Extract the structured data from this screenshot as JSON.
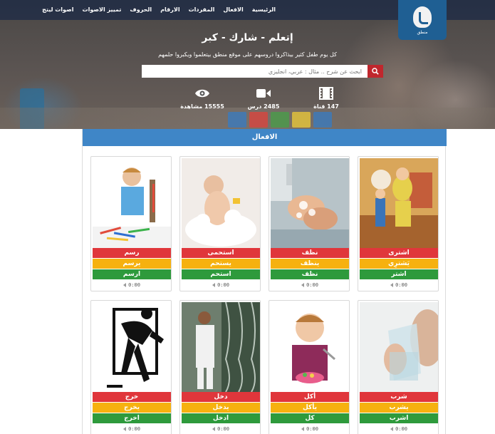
{
  "nav": {
    "items": [
      "الرئيسية",
      "الافعال",
      "المفردات",
      "الارقام",
      "الحروف",
      "تمييز الاصوات",
      "اصوات ليتج"
    ]
  },
  "hero": {
    "title": "إتعلم - شارك - كبر",
    "subtitle": "كل يوم طفل كثير بيذاكروا دروسهم على موقع منطق بيتعلموا ويكبروا حلمهم",
    "search_placeholder": "ابحث عن شرح .. مثال : عربي، انجليزي",
    "stats": [
      {
        "icon": "film-icon",
        "label": "147 قناة"
      },
      {
        "icon": "video-camera-icon",
        "label": "2485 درس"
      },
      {
        "icon": "eye-icon",
        "label": "15555 مشاهدة"
      }
    ]
  },
  "section": {
    "title": "الافعال"
  },
  "cards": [
    {
      "words": [
        "اشترى",
        "يَشترِي",
        "اشتر"
      ],
      "time": "0:00",
      "image": "shopping-illustration"
    },
    {
      "words": [
        "نظف",
        "ينظف",
        "نظف"
      ],
      "time": "0:00",
      "image": "washing-hands-photo"
    },
    {
      "words": [
        "استحمى",
        "يستحم",
        "استحم"
      ],
      "time": "0:00",
      "image": "bathing-baby-photo"
    },
    {
      "words": [
        "رسم",
        "يرسم",
        "ارسم"
      ],
      "time": "0:00",
      "image": "child-drawing-photo"
    },
    {
      "words": [
        "شرب",
        "يشرب",
        "اشرب"
      ],
      "time": "0:00",
      "image": "drinking-water-photo"
    },
    {
      "words": [
        "أكل",
        "يأكل",
        "كل"
      ],
      "time": "0:00",
      "image": "child-eating-photo"
    },
    {
      "words": [
        "دخل",
        "يدخل",
        "ادخل"
      ],
      "time": "0:00",
      "image": "man-entering-door-photo"
    },
    {
      "words": [
        "خرج",
        "يخرج",
        "اخرج"
      ],
      "time": "0:00",
      "image": "man-leaving-illustration"
    }
  ],
  "colors": {
    "nav_bg": "#0a1e46",
    "section_header": "#3f86c7",
    "word_past": "#e0363b",
    "word_present": "#f6b10f",
    "word_imperative": "#2e9a3c",
    "search_button": "#c0272d"
  }
}
